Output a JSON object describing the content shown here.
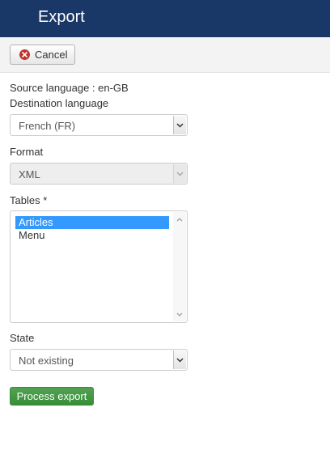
{
  "header": {
    "title": "Export"
  },
  "toolbar": {
    "cancel_label": "Cancel"
  },
  "form": {
    "source_language": "Source language : en-GB",
    "destination_label": "Destination language",
    "destination_value": "French (FR)",
    "format_label": "Format",
    "format_value": "XML",
    "tables_label": "Tables *",
    "tables_options": [
      {
        "label": "Articles",
        "selected": true
      },
      {
        "label": "Menu",
        "selected": false
      }
    ],
    "state_label": "State",
    "state_value": "Not existing",
    "submit_label": "Process export"
  },
  "colors": {
    "header_bg": "#1a3867",
    "cancel_icon": "#bd362f",
    "selected_option": "#3399ff",
    "submit_bg": "#46a046"
  },
  "icons": {
    "cancel": "times-circle-icon",
    "dropdown": "chevron-down-icon"
  }
}
